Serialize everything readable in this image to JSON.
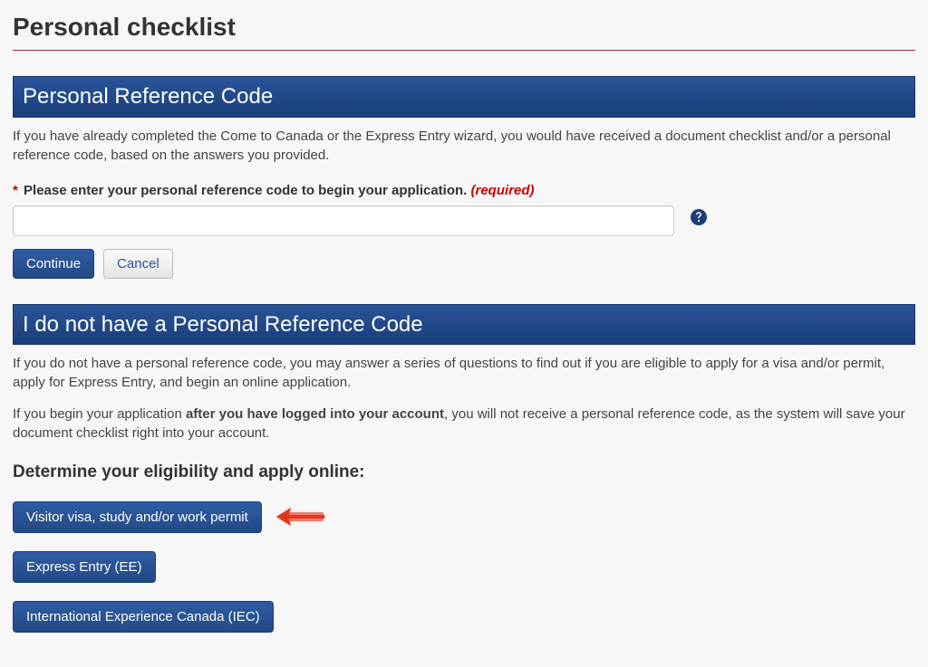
{
  "page_title": "Personal checklist",
  "section1": {
    "header": "Personal Reference Code",
    "description": "If you have already completed the Come to Canada or the Express Entry wizard, you would have received a document checklist and/or a personal reference code, based on the answers you provided.",
    "field_label": "Please enter your personal reference code to begin your application.",
    "required_text": "(required)",
    "input_value": "",
    "continue_label": "Continue",
    "cancel_label": "Cancel"
  },
  "section2": {
    "header": "I do not have a Personal Reference Code",
    "para1": "If you do not have a personal reference code, you may answer a series of questions to find out if you are eligible to apply for a visa and/or permit, apply for Express Entry, and begin an online application.",
    "para2_a": "If you begin your application ",
    "para2_b": "after you have logged into your account",
    "para2_c": ", you will not receive a personal reference code, as the system will save your document checklist right into your account.",
    "sub_heading": "Determine your eligibility and apply online:",
    "option1": "Visitor visa, study and/or work permit",
    "option2": "Express Entry (EE)",
    "option3": "International Experience Canada (IEC)"
  }
}
